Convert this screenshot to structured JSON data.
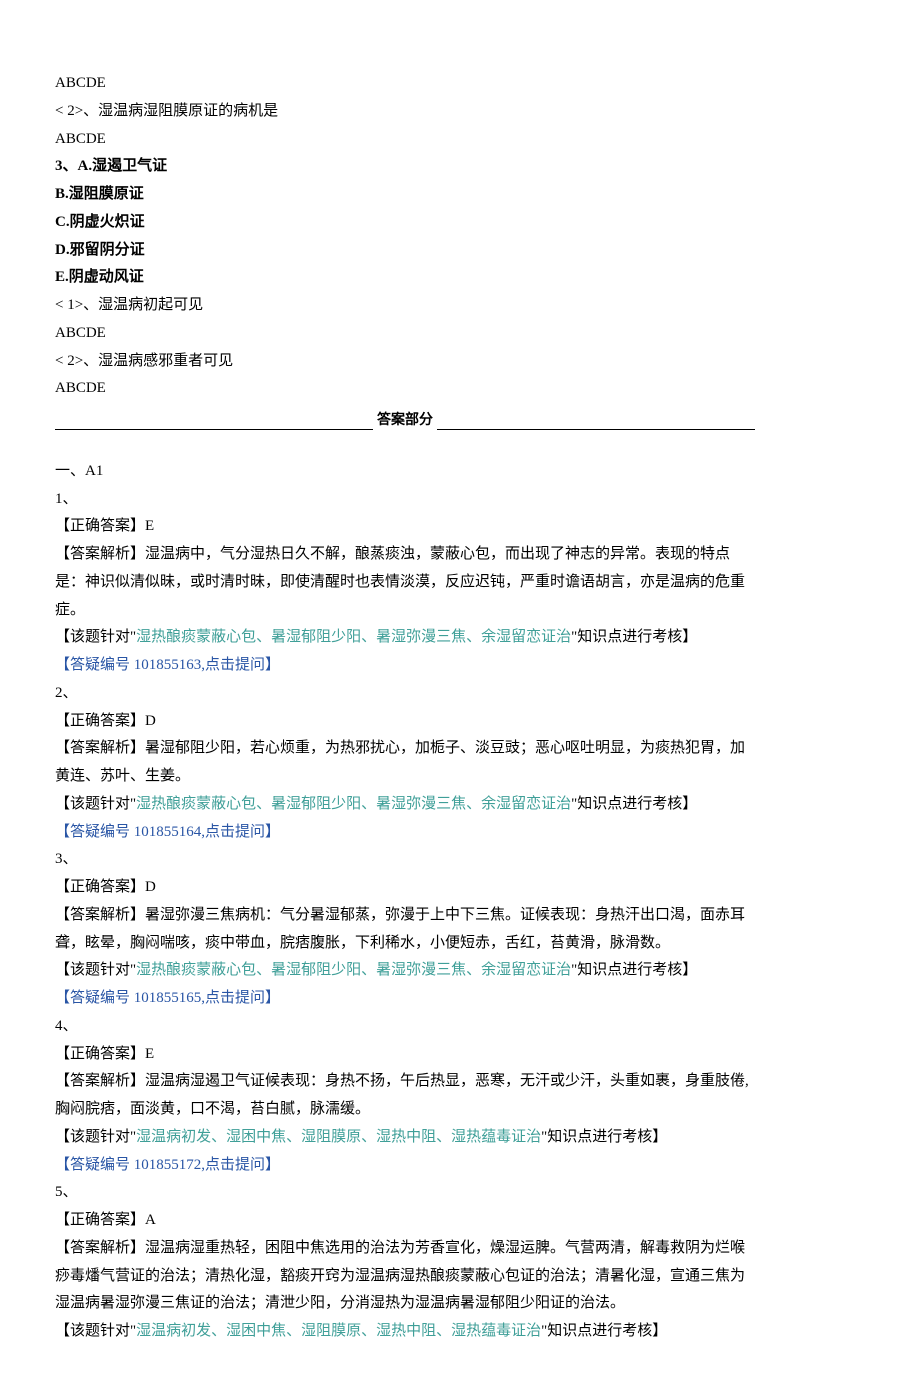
{
  "q2prev": {
    "abcde": "ABCDE",
    "sub2": "< 2>、湿温病湿阻膜原证的病机是",
    "abcde2": "ABCDE"
  },
  "q3": {
    "stem": "3、A.湿遏卫气证",
    "b": "B.湿阻膜原证",
    "c": "C.阴虚火炽证",
    "d": "D.邪留阴分证",
    "e": "E.阴虚动风证",
    "sub1": "< 1>、湿温病初起可见",
    "abcde1": "ABCDE",
    "sub2": "< 2>、湿温病感邪重者可见",
    "abcde2": "ABCDE"
  },
  "answerHeader": "答案部分",
  "sectionA1": "一、A1",
  "answers": [
    {
      "num": "1、",
      "correctLabel": "【正确答案】",
      "correctVal": "E",
      "explainLabel": "【答案解析】",
      "explainText": "湿温病中，气分湿热日久不解，酿蒸痰浊，蒙蔽心包，而出现了神志的异常。表现的特点是：神识似清似昧，或时清时昧，即使清醒时也表情淡漠，反应迟钝，严重时谵语胡言，亦是温病的危重症。",
      "topicLabel": "【该题针对\"",
      "topicTeal": "湿热酿痰蒙蔽心包、暑湿郁阻少阳、暑湿弥漫三焦、余湿留恋证治",
      "topicSuffix": "\"知识点进行考核】",
      "feedback": "【答疑编号 101855163,点击提问】"
    },
    {
      "num": "2、",
      "correctLabel": "【正确答案】",
      "correctVal": "D",
      "explainLabel": "【答案解析】",
      "explainText": "暑湿郁阻少阳，若心烦重，为热邪扰心，加栀子、淡豆豉；恶心呕吐明显，为痰热犯胃，加黄连、苏叶、生姜。",
      "topicLabel": "【该题针对\"",
      "topicTeal": "湿热酿痰蒙蔽心包、暑湿郁阻少阳、暑湿弥漫三焦、余湿留恋证治",
      "topicSuffix": "\"知识点进行考核】",
      "feedback": "【答疑编号 101855164,点击提问】"
    },
    {
      "num": "3、",
      "correctLabel": "【正确答案】",
      "correctVal": "D",
      "explainLabel": "【答案解析】",
      "explainText": "暑湿弥漫三焦病机：气分暑湿郁蒸，弥漫于上中下三焦。证候表现：身热汗出口渴，面赤耳聋，眩晕，胸闷喘咳，痰中带血，脘痞腹胀，下利稀水，小便短赤，舌红，苔黄滑，脉滑数。",
      "topicLabel": "【该题针对\"",
      "topicTeal": "湿热酿痰蒙蔽心包、暑湿郁阻少阳、暑湿弥漫三焦、余湿留恋证治",
      "topicSuffix": "\"知识点进行考核】",
      "feedback": "【答疑编号 101855165,点击提问】"
    },
    {
      "num": "4、",
      "correctLabel": "【正确答案】",
      "correctVal": "E",
      "explainLabel": "【答案解析】",
      "explainText": "湿温病湿遏卫气证候表现：身热不扬，午后热显，恶寒，无汗或少汗，头重如裹，身重肢倦,胸闷脘痞，面淡黄，口不渴，苔白腻，脉濡缓。",
      "topicLabel": "【该题针对\"",
      "topicTeal": "湿温病初发、湿困中焦、湿阻膜原、湿热中阻、湿热蕴毒证治",
      "topicSuffix": "\"知识点进行考核】",
      "feedback": "【答疑编号 101855172,点击提问】"
    },
    {
      "num": "5、",
      "correctLabel": "【正确答案】",
      "correctVal": "A",
      "explainLabel": "【答案解析】",
      "explainText": "湿温病湿重热轻，困阻中焦选用的治法为芳香宣化，燥湿运脾。气营两清，解毒救阴为烂喉痧毒燔气营证的治法；清热化湿，豁痰开窍为湿温病湿热酿痰蒙蔽心包证的治法；清暑化湿，宣通三焦为湿温病暑湿弥漫三焦证的治法；清泄少阳，分消湿热为湿温病暑湿郁阻少阳证的治法。",
      "topicLabel": "【该题针对\"",
      "topicTeal": "湿温病初发、湿困中焦、湿阻膜原、湿热中阻、湿热蕴毒证治",
      "topicSuffix": "\"知识点进行考核】",
      "feedback": ""
    }
  ]
}
